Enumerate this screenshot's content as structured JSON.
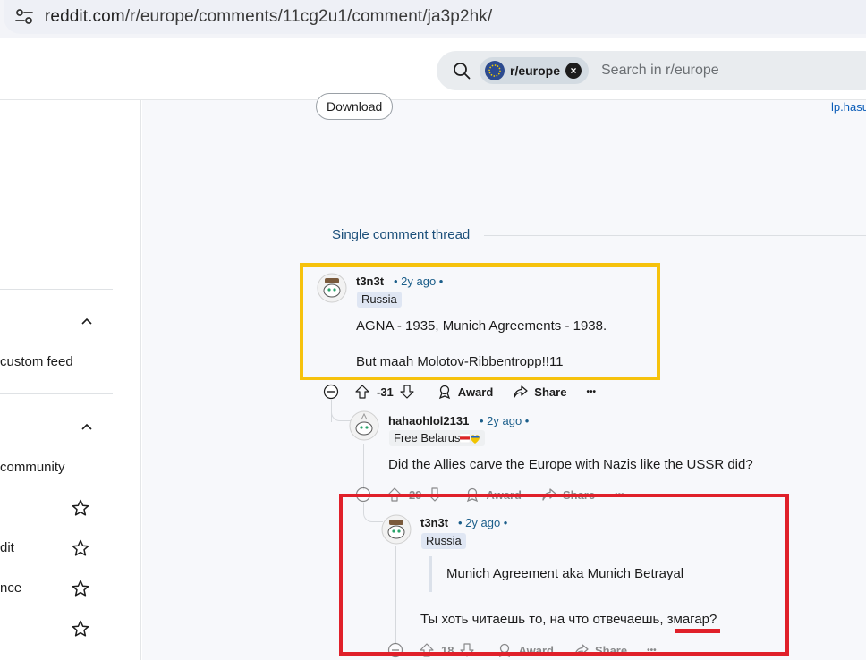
{
  "browser": {
    "url_host": "reddit.com",
    "url_path": "/r/europe/comments/11cg2u1/comment/ja3p2hk/"
  },
  "header": {
    "subreddit_chip": "r/europe",
    "search_placeholder": "Search in r/europe"
  },
  "sidebar": {
    "items": [
      {
        "label": "custom feed"
      },
      {
        "label": "community"
      },
      {
        "label": "dit"
      },
      {
        "label": "nce"
      }
    ]
  },
  "main": {
    "download_label": "Download",
    "link_text": "lp.hasu",
    "thread_label": "Single comment thread"
  },
  "comments": [
    {
      "username": "t3n3t",
      "time": "• 2y ago •",
      "flair": "Russia",
      "lines": [
        "AGNA - 1935, Munich Agreements - 1938.",
        "But maah Molotov-Ribbentropp!!11"
      ],
      "score": "-31",
      "award_label": "Award",
      "share_label": "Share",
      "more_label": "•••"
    },
    {
      "username": "hahaohlol2131",
      "time": "• 2y ago •",
      "flair": "Free Belarus",
      "lines": [
        "Did the Allies carve the Europe with Nazis like the USSR did?"
      ],
      "score": "29",
      "award_label": "Award",
      "share_label": "Share",
      "more_label": "•••"
    },
    {
      "username": "t3n3t",
      "time": "• 2y ago •",
      "flair": "Russia",
      "quote": "Munich Agreement aka Munich Betrayal",
      "lines": [
        "Ты хоть читаешь то, на что отвечаешь, змагар?"
      ],
      "score": "18",
      "award_label": "Award",
      "share_label": "Share",
      "more_label": "•••"
    }
  ],
  "colors": {
    "highlight_yellow": "#f6c20c",
    "highlight_red": "#e0202a",
    "link_blue": "#1b5e8a"
  }
}
